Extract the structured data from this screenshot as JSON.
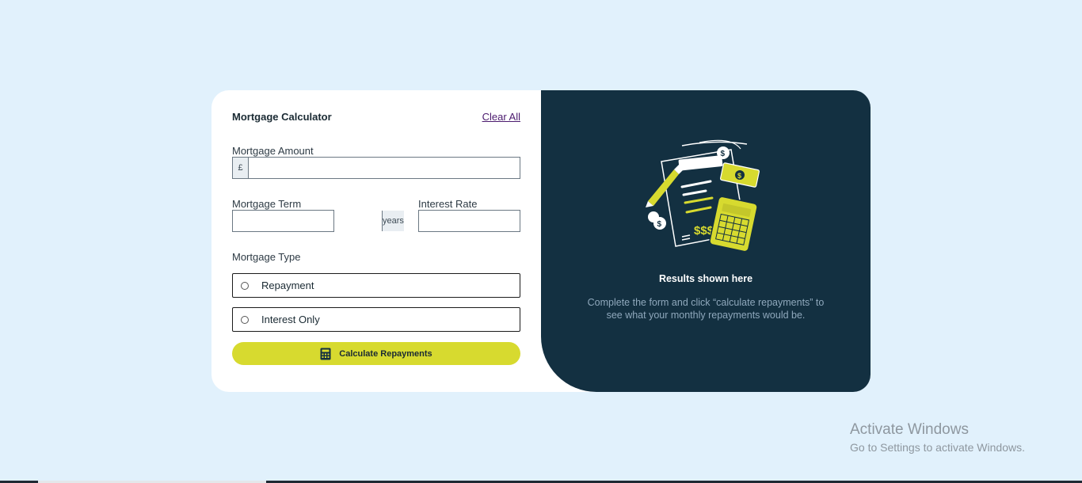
{
  "form": {
    "title": "Mortgage Calculator",
    "clear_label": "Clear All",
    "amount": {
      "label": "Mortgage Amount",
      "prefix": "£",
      "value": ""
    },
    "term": {
      "label": "Mortgage Term",
      "suffix": "years",
      "value": ""
    },
    "rate": {
      "label": "Interest Rate",
      "suffix": "%",
      "value": ""
    },
    "type": {
      "label": "Mortgage Type",
      "options": [
        {
          "label": "Repayment",
          "selected": false
        },
        {
          "label": "Interest Only",
          "selected": false
        }
      ]
    },
    "submit_label": "Calculate Repayments"
  },
  "results": {
    "title": "Results shown here",
    "description": "Complete the form and click “calculate repayments” to see what your monthly repayments would be."
  },
  "watermark": {
    "line1": "Activate Windows",
    "line2": "Go to Settings to activate Windows."
  },
  "colors": {
    "background": "#e1f1fc",
    "accent_lime": "#d7da2f",
    "results_panel": "#133041",
    "link": "#4b1a6e"
  },
  "icons": [
    "calculator-icon",
    "empty-results-illustration"
  ]
}
